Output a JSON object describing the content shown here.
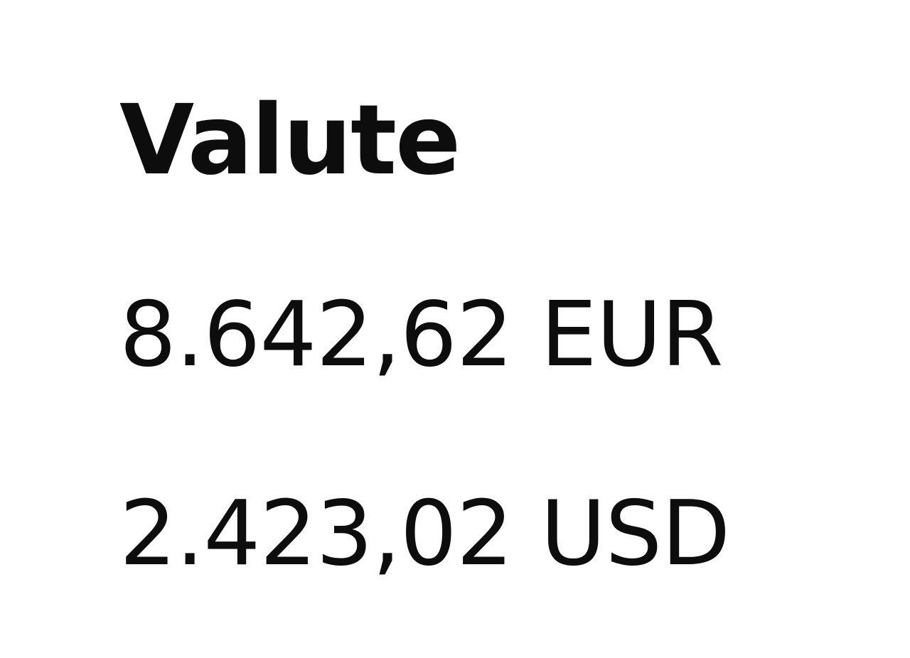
{
  "section": {
    "title": "Valute"
  },
  "balances": [
    {
      "amount": "8.642,62",
      "currency": "EUR",
      "display": "8.642,62 EUR"
    },
    {
      "amount": "2.423,02",
      "currency": "USD",
      "display": "2.423,02 USD"
    }
  ],
  "colors": {
    "text": "#0d0d0d",
    "background": "#ffffff"
  }
}
